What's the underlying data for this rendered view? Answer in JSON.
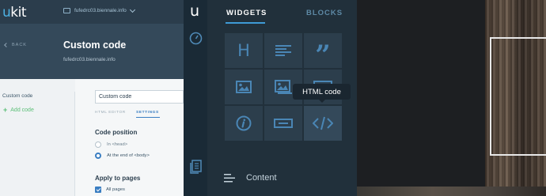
{
  "app": {
    "logo": "ukit",
    "site": "fufedrc03.biennale.info"
  },
  "header": {
    "back_label": "BACK",
    "title": "Custom code",
    "subtitle": "fufedrc03.biennale.info"
  },
  "codes": {
    "items": [
      "Custom code"
    ],
    "add_label": "Add code"
  },
  "settings": {
    "name_value": "Custom code",
    "tabs": [
      "HTML EDITOR",
      "SETTINGS"
    ],
    "active_tab": "SETTINGS",
    "position_heading": "Code position",
    "position_options": [
      "In <head>",
      "At the end of <body>"
    ],
    "position_selected": "At the end of <body>",
    "apply_heading": "Apply to pages",
    "all_pages_label": "All pages",
    "all_pages_checked": true
  },
  "rail": {
    "logo": "u",
    "icons": [
      "speedometer-icon",
      "pages-icon"
    ]
  },
  "panel": {
    "tabs": [
      "WIDGETS",
      "BLOCKS"
    ],
    "active_tab": "WIDGETS",
    "widgets": [
      "heading-icon",
      "text-icon",
      "quote-icon",
      "image-icon",
      "image-text-icon",
      "video-icon",
      "info-icon",
      "button-icon",
      "html-code-icon"
    ],
    "tooltip": "HTML code",
    "content_label": "Content"
  },
  "colors": {
    "accent": "#3e9bd6",
    "icon": "#4a86b5",
    "panel_bg": "#21303b",
    "add_green": "#5bbf77"
  }
}
